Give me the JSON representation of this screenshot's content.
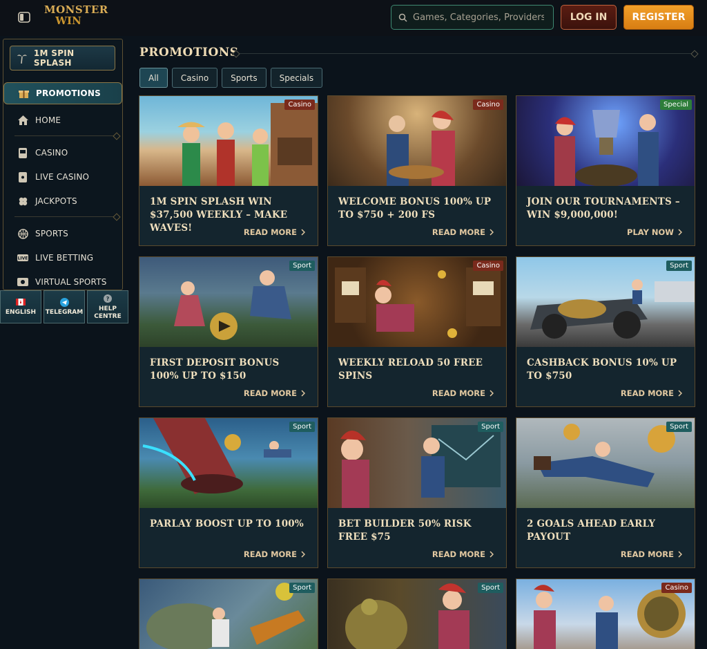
{
  "header": {
    "logo_line1": "MONSTER",
    "logo_line2": "WIN",
    "search_placeholder": "Games, Categories, Providers",
    "login_label": "LOG IN",
    "register_label": "REGISTER"
  },
  "sidebar": {
    "promo_button": "1M SPIN SPLASH",
    "items": [
      {
        "label": "PROMOTIONS",
        "icon": "gift-icon"
      },
      {
        "label": "HOME",
        "icon": "home-icon"
      },
      {
        "label": "CASINO",
        "icon": "slot-machine-icon"
      },
      {
        "label": "LIVE CASINO",
        "icon": "playing-card-icon"
      },
      {
        "label": "JACKPOTS",
        "icon": "clover-icon"
      },
      {
        "label": "SPORTS",
        "icon": "basketball-icon"
      },
      {
        "label": "LIVE BETTING",
        "icon": "live-badge-icon"
      },
      {
        "label": "VIRTUAL SPORTS",
        "icon": "virtual-sports-icon"
      }
    ],
    "tiles": [
      {
        "label": "ENGLISH",
        "icon": "canada-flag-icon"
      },
      {
        "label": "TELEGRAM",
        "icon": "telegram-icon"
      },
      {
        "label": "HELP CENTRE",
        "icon": "help-icon"
      }
    ]
  },
  "main": {
    "title": "PROMOTIONS",
    "filters": [
      "All",
      "Casino",
      "Sports",
      "Specials"
    ],
    "active_filter": "All",
    "cards": [
      {
        "tag": "Casino",
        "title": "1M SPIN SPLASH WIN $37,500 WEEKLY – MAKE WAVES!",
        "cta": "READ MORE"
      },
      {
        "tag": "Casino",
        "title": "WELCOME BONUS 100% UP TO $750 + 200 FS",
        "cta": "READ MORE"
      },
      {
        "tag": "Special",
        "title": "JOIN OUR TOURNAMENTS – WIN $9,000,000!",
        "cta": "PLAY NOW"
      },
      {
        "tag": "Sport",
        "title": "FIRST DEPOSIT BONUS 100% UP TO $150",
        "cta": "READ MORE"
      },
      {
        "tag": "Casino",
        "title": "WEEKLY RELOAD 50 FREE SPINS",
        "cta": "READ MORE"
      },
      {
        "tag": "Sport",
        "title": "CASHBACK BONUS 10% UP TO $750",
        "cta": "READ MORE"
      },
      {
        "tag": "Sport",
        "title": "PARLAY BOOST UP TO 100%",
        "cta": "READ MORE"
      },
      {
        "tag": "Sport",
        "title": "BET BUILDER 50% RISK FREE $75",
        "cta": "READ MORE"
      },
      {
        "tag": "Sport",
        "title": "2 GOALS AHEAD EARLY PAYOUT",
        "cta": "READ MORE"
      },
      {
        "tag": "Sport",
        "title": "",
        "cta": ""
      },
      {
        "tag": "Sport",
        "title": "",
        "cta": ""
      },
      {
        "tag": "Casino",
        "title": "",
        "cta": ""
      }
    ]
  },
  "colors": {
    "tag_casino": "#7a2a1c",
    "tag_sport": "#1f5d5f",
    "tag_special": "#2d7d3a",
    "accent_gold": "#d9ac55",
    "register_orange": "#f0951f"
  }
}
